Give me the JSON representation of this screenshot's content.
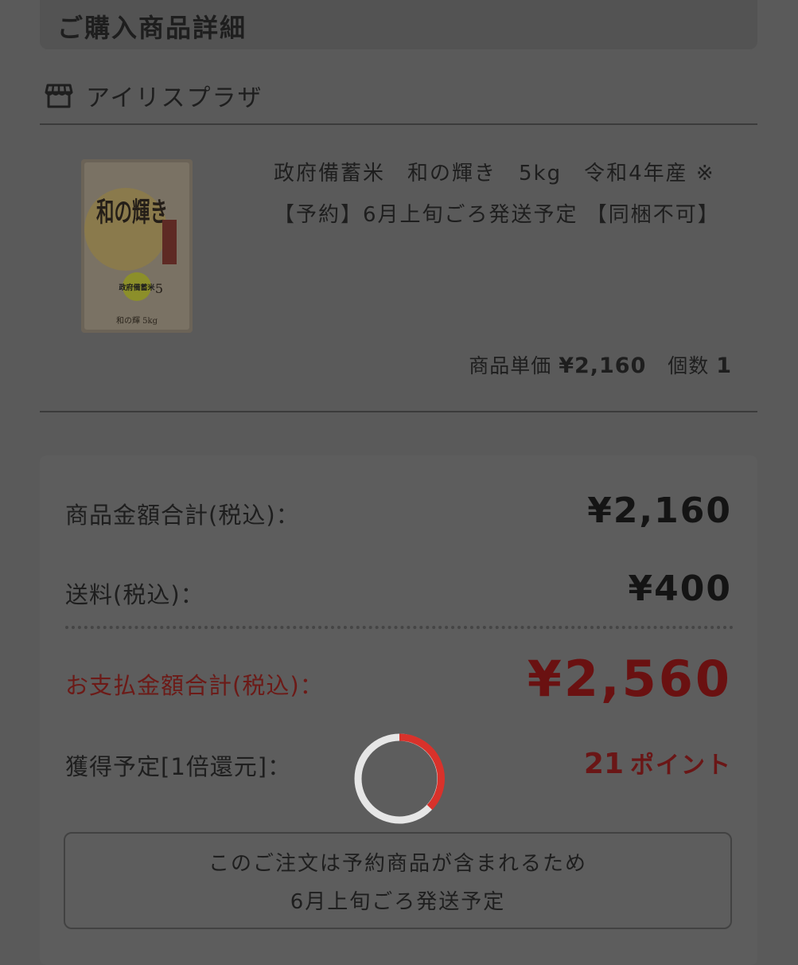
{
  "section": {
    "title": "ご購入商品詳細"
  },
  "shop": {
    "name": "アイリスプラザ",
    "icon": "store-icon"
  },
  "product": {
    "image": {
      "bag_text_large": "和の輝き",
      "badge_text": "政府備蓄米",
      "weight_text": "5",
      "bottom_text": "和の輝 5kg"
    },
    "name": "政府備蓄米　和の輝き　5kg　令和4年産 ※【予約】6月上旬ごろ発送予定 【同梱不可】",
    "unit_price_label": "商品単価",
    "unit_price": "¥2,160",
    "quantity_label": "個数",
    "quantity": "1"
  },
  "summary": {
    "subtotal_label": "商品金額合計(税込)：",
    "subtotal": "¥2,160",
    "shipping_label": "送料(税込)：",
    "shipping": "¥400",
    "total_label": "お支払金額合計(税込)：",
    "total": "¥2,560",
    "points_label": "獲得予定[1倍還元]：",
    "points_value": "21",
    "points_unit": "ポイント"
  },
  "notice": {
    "line1": "このご注文は予約商品が含まれるため",
    "line2": "6月上旬ごろ発送予定"
  },
  "colors": {
    "overlay_background": "#5a5a5a",
    "total_accent": "#6a1111",
    "spinner_accent": "#d9322b",
    "spinner_track": "#e6e6e6"
  },
  "spinner": {
    "state": "loading"
  }
}
